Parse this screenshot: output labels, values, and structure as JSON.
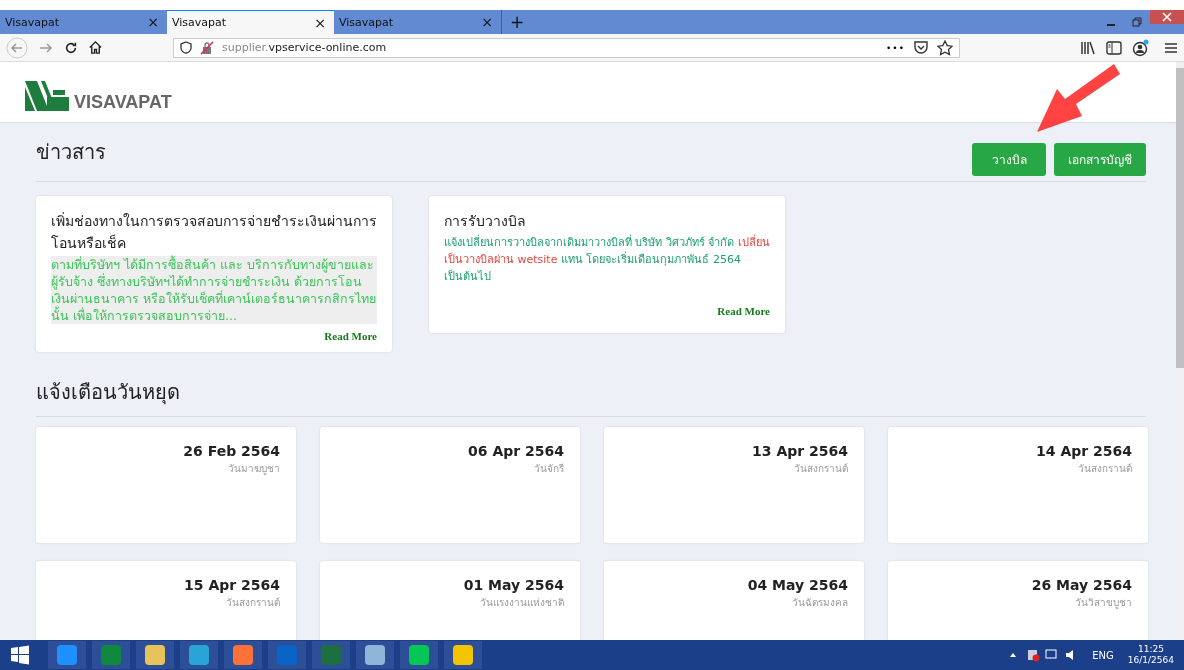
{
  "browser": {
    "tabs": [
      {
        "title": "Visavapat",
        "close": "×",
        "selected": false
      },
      {
        "title": "Visavapat",
        "close": "×",
        "selected": true
      },
      {
        "title": "Visavapat",
        "close": "×",
        "selected": false
      }
    ],
    "new_tab": "+",
    "url_prefix": "supplier.",
    "url_domain": "vpservice-online.com",
    "more": "•••"
  },
  "site": {
    "logo_text": "VISAVAPAT"
  },
  "news": {
    "heading": "ข่าวสาร",
    "buttons": [
      "วางบิล",
      "เอกสารบัญชี"
    ],
    "cards": [
      {
        "title": "เพิ่มช่องทางในการตรวจสอบการจ่ายชำระเงินผ่านการโอนหรือเช็ค",
        "kind": "highlighted",
        "segments": [
          {
            "text": "ตามที่บริษัทฯ ได้มีการซื้อสินค้า และ บริการกับทางผู้ขายและผู้รับจ้าง ซึ่งทางบริษัทฯได้ทำการจ่ายชำระเงิน ด้วยการโอนเงินผ่านธนาคาร หรือให้รับเช็คที่เคาน์เตอร์ธนาคารกสิกรไทยนั้น เพื่อให้การตรวจสอบการจ่าย...",
            "color": "#3dc55a"
          }
        ],
        "read_more": "Read More"
      },
      {
        "title": "การรับวางบิล",
        "kind": "plain",
        "segments": [
          {
            "text": "แจ้งเปลี่ยนการวางบิลจากเดิมมาวางบิลที่ บริษัท วิศวภัทร์ จำกัด",
            "color": "#1c9e70"
          },
          {
            "text": "เปลี่ยนเป็นวางบิลผ่าน wetsite",
            "color": "#e0463c"
          },
          {
            "text": "แทน โดยจะเริ่มเดือนกุมภาพันธ์ 2564 เป็นต้นไป",
            "color": "#1c9e70"
          }
        ],
        "read_more": "Read More"
      }
    ]
  },
  "holidays": {
    "heading": "แจ้งเตือนวันหยุด",
    "items": [
      {
        "date": "26 Feb 2564",
        "name": "วันมาฆบูชา"
      },
      {
        "date": "06 Apr 2564",
        "name": "วันจักรี"
      },
      {
        "date": "13 Apr 2564",
        "name": "วันสงกรานต์"
      },
      {
        "date": "14 Apr 2564",
        "name": "วันสงกรานต์"
      },
      {
        "date": "15 Apr 2564",
        "name": "วันสงกรานต์"
      },
      {
        "date": "01 May 2564",
        "name": "วันแรงงานแห่งชาติ"
      },
      {
        "date": "04 May 2564",
        "name": "วันฉัตรมงคล"
      },
      {
        "date": "26 May 2564",
        "name": "วันวิสาขบูชา"
      }
    ]
  },
  "taskbar": {
    "language": "ENG",
    "time": "11:25",
    "date": "16/1/2564"
  }
}
